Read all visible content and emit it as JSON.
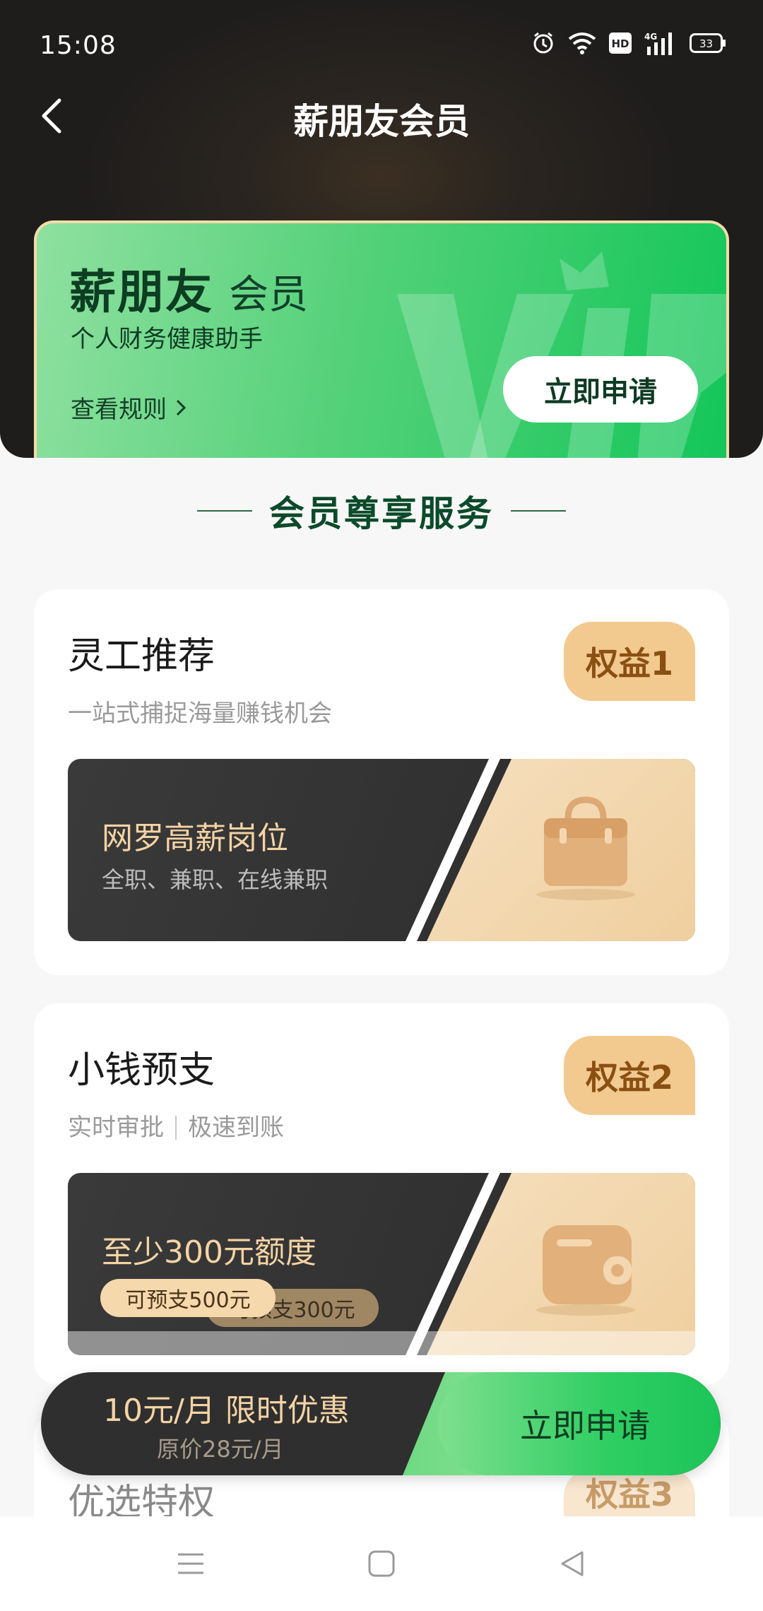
{
  "status_bar": {
    "time": "15:08",
    "network": "4G",
    "hd": "HD",
    "battery": "33",
    "icons": [
      "alarm-icon",
      "wifi-icon",
      "hd-icon",
      "signal-icon",
      "battery-icon"
    ]
  },
  "nav": {
    "title": "薪朋友会员",
    "back_icon": "chevron-left-icon"
  },
  "vip_card": {
    "brand": "薪朋友",
    "member": "会员",
    "subtitle": "个人财务健康助手",
    "rules_link": "查看规则",
    "apply_button": "立即申请"
  },
  "section": {
    "title": "会员尊享服务"
  },
  "benefits": [
    {
      "title": "灵工推荐",
      "subtitle": "一站式捕捉海量赚钱机会",
      "badge": "权益1",
      "promo_title": "网罗高薪岗位",
      "promo_subtitle": "全职、兼职、在线兼职",
      "icon": "briefcase-icon"
    },
    {
      "title": "小钱预支",
      "subtitle_parts": [
        "实时审批",
        "极速到账"
      ],
      "badge": "权益2",
      "promo_title": "至少300元额度",
      "pill_front": "可预支500元",
      "pill_back": "可预支300元",
      "icon": "wallet-icon"
    },
    {
      "title": "优选特权",
      "badge": "权益3"
    }
  ],
  "float_bar": {
    "price": "10元/月 限时优惠",
    "original": "原价28元/月",
    "apply_button": "立即申请"
  },
  "system_nav": {
    "icons": [
      "menu-icon",
      "home-square-icon",
      "back-triangle-icon"
    ]
  },
  "colors": {
    "accent_green": "#1cc457",
    "gold": "#f2c98f",
    "dark": "#2b2b2b"
  }
}
